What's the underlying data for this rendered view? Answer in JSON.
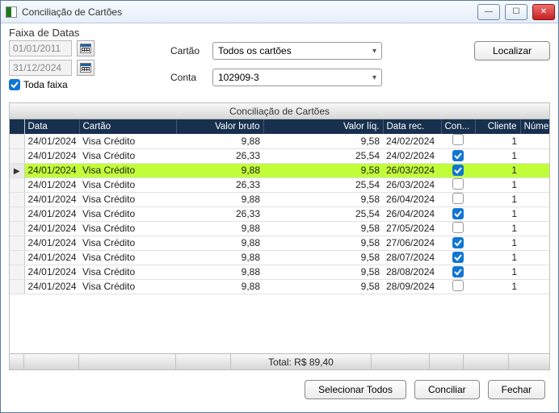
{
  "window": {
    "title": "Conciliação de Cartões"
  },
  "faixa": {
    "title": "Faixa de Datas",
    "start": "01/01/2011",
    "end": "31/12/2024",
    "toda_label": "Toda faixa",
    "toda_checked": true
  },
  "form": {
    "cartao_label": "Cartão",
    "cartao_value": "Todos os cartões",
    "conta_label": "Conta",
    "conta_value": "102909-3",
    "localizar": "Localizar"
  },
  "grid": {
    "title": "Conciliação de Cartões",
    "headers": {
      "data": "Data",
      "cartao": "Cartão",
      "valor_bruto": "Valor bruto",
      "valor_liq": "Valor líq.",
      "data_rec": "Data rec.",
      "con": "Con...",
      "cliente": "Cliente",
      "numero": "Número"
    },
    "rows": [
      {
        "data": "24/01/2024",
        "cartao": "Visa Crédito",
        "valor_bruto": "9,88",
        "valor_liq": "9,58",
        "data_rec": "24/02/2024",
        "con": false,
        "cliente": "1",
        "selected": false
      },
      {
        "data": "24/01/2024",
        "cartao": "Visa Crédito",
        "valor_bruto": "26,33",
        "valor_liq": "25,54",
        "data_rec": "24/02/2024",
        "con": true,
        "cliente": "1",
        "selected": false
      },
      {
        "data": "24/01/2024",
        "cartao": "Visa Crédito",
        "valor_bruto": "9,88",
        "valor_liq": "9,58",
        "data_rec": "26/03/2024",
        "con": true,
        "cliente": "1",
        "selected": true
      },
      {
        "data": "24/01/2024",
        "cartao": "Visa Crédito",
        "valor_bruto": "26,33",
        "valor_liq": "25,54",
        "data_rec": "26/03/2024",
        "con": false,
        "cliente": "1",
        "selected": false
      },
      {
        "data": "24/01/2024",
        "cartao": "Visa Crédito",
        "valor_bruto": "9,88",
        "valor_liq": "9,58",
        "data_rec": "26/04/2024",
        "con": false,
        "cliente": "1",
        "selected": false
      },
      {
        "data": "24/01/2024",
        "cartao": "Visa Crédito",
        "valor_bruto": "26,33",
        "valor_liq": "25,54",
        "data_rec": "26/04/2024",
        "con": true,
        "cliente": "1",
        "selected": false
      },
      {
        "data": "24/01/2024",
        "cartao": "Visa Crédito",
        "valor_bruto": "9,88",
        "valor_liq": "9,58",
        "data_rec": "27/05/2024",
        "con": false,
        "cliente": "1",
        "selected": false
      },
      {
        "data": "24/01/2024",
        "cartao": "Visa Crédito",
        "valor_bruto": "9,88",
        "valor_liq": "9,58",
        "data_rec": "27/06/2024",
        "con": true,
        "cliente": "1",
        "selected": false
      },
      {
        "data": "24/01/2024",
        "cartao": "Visa Crédito",
        "valor_bruto": "9,88",
        "valor_liq": "9,58",
        "data_rec": "28/07/2024",
        "con": true,
        "cliente": "1",
        "selected": false
      },
      {
        "data": "24/01/2024",
        "cartao": "Visa Crédito",
        "valor_bruto": "9,88",
        "valor_liq": "9,58",
        "data_rec": "28/08/2024",
        "con": true,
        "cliente": "1",
        "selected": false
      },
      {
        "data": "24/01/2024",
        "cartao": "Visa Crédito",
        "valor_bruto": "9,88",
        "valor_liq": "9,58",
        "data_rec": "28/09/2024",
        "con": false,
        "cliente": "1",
        "selected": false
      }
    ],
    "footer_total": "Total: R$ 89,40"
  },
  "actions": {
    "selecionar": "Selecionar Todos",
    "conciliar": "Conciliar",
    "fechar": "Fechar"
  }
}
